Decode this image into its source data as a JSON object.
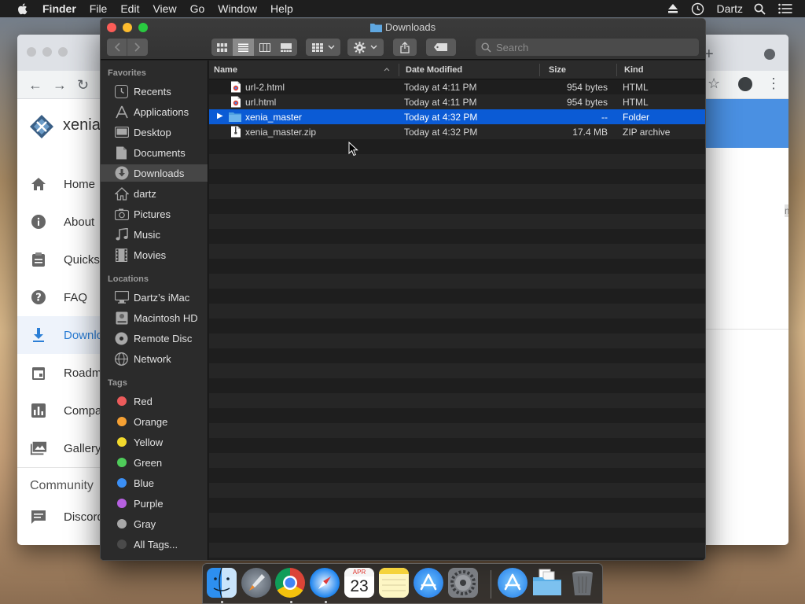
{
  "menubar": {
    "app": "Finder",
    "items": [
      "File",
      "Edit",
      "View",
      "Go",
      "Window",
      "Help"
    ],
    "user": "Dartz",
    "icons": [
      "apple-icon",
      "eject-icon",
      "time-machine-icon",
      "spotlight-icon",
      "notification-center-icon"
    ]
  },
  "browser": {
    "site_name": "xenia",
    "nav": [
      {
        "label": "Home",
        "icon": "home-icon"
      },
      {
        "label": "About",
        "icon": "info-icon"
      },
      {
        "label": "Quicks",
        "icon": "clipboard-icon"
      },
      {
        "label": "FAQ",
        "icon": "help-icon"
      },
      {
        "label": "Downlo",
        "icon": "download-icon"
      },
      {
        "label": "Roadm",
        "icon": "calendar-icon"
      },
      {
        "label": "Compa",
        "icon": "chart-icon"
      },
      {
        "label": "Gallery",
        "icon": "gallery-icon"
      }
    ],
    "community": "Community",
    "discord": "Discord",
    "edge_letter": "m"
  },
  "finder": {
    "title": "Downloads",
    "search_placeholder": "Search",
    "sidebar": {
      "favorites_header": "Favorites",
      "favorites": [
        {
          "label": "Recents",
          "icon": "recents-icon"
        },
        {
          "label": "Applications",
          "icon": "applications-icon"
        },
        {
          "label": "Desktop",
          "icon": "desktop-icon"
        },
        {
          "label": "Documents",
          "icon": "documents-icon"
        },
        {
          "label": "Downloads",
          "icon": "downloads-icon",
          "selected": true
        },
        {
          "label": "dartz",
          "icon": "home-icon"
        },
        {
          "label": "Pictures",
          "icon": "pictures-icon"
        },
        {
          "label": "Music",
          "icon": "music-icon"
        },
        {
          "label": "Movies",
          "icon": "movies-icon"
        }
      ],
      "locations_header": "Locations",
      "locations": [
        {
          "label": "Dartz’s iMac",
          "icon": "imac-icon"
        },
        {
          "label": "Macintosh HD",
          "icon": "hard-disk-icon"
        },
        {
          "label": "Remote Disc",
          "icon": "disc-icon"
        },
        {
          "label": "Network",
          "icon": "network-icon"
        }
      ],
      "tags_header": "Tags",
      "tags": [
        {
          "label": "Red",
          "color": "#ec5b5b"
        },
        {
          "label": "Orange",
          "color": "#f5a033"
        },
        {
          "label": "Yellow",
          "color": "#f2d92c"
        },
        {
          "label": "Green",
          "color": "#4fcc5a"
        },
        {
          "label": "Blue",
          "color": "#3b8ff5"
        },
        {
          "label": "Purple",
          "color": "#b660e0"
        },
        {
          "label": "Gray",
          "color": "#a8a8a8"
        },
        {
          "label": "All Tags...",
          "color": "#4a4a4a"
        }
      ]
    },
    "columns": {
      "name": "Name",
      "date": "Date Modified",
      "size": "Size",
      "kind": "Kind"
    },
    "files": [
      {
        "name": "url-2.html",
        "date": "Today at 4:11 PM",
        "size": "954 bytes",
        "kind": "HTML",
        "icon": "html-file-icon"
      },
      {
        "name": "url.html",
        "date": "Today at 4:11 PM",
        "size": "954 bytes",
        "kind": "HTML",
        "icon": "html-file-icon"
      },
      {
        "name": "xenia_master",
        "date": "Today at 4:32 PM",
        "size": "--",
        "kind": "Folder",
        "icon": "folder-icon",
        "selected": true
      },
      {
        "name": "xenia_master.zip",
        "date": "Today at 4:32 PM",
        "size": "17.4 MB",
        "kind": "ZIP archive",
        "icon": "zip-file-icon"
      }
    ]
  },
  "dock": {
    "apps": [
      "finder-icon",
      "launchpad-icon",
      "chrome-icon",
      "safari-icon",
      "calendar-icon",
      "notes-icon",
      "app-store-icon",
      "system-preferences-icon",
      "applications-folder-icon",
      "downloads-folder-icon",
      "trash-icon"
    ],
    "calendar_month": "APR",
    "calendar_day": "23"
  }
}
